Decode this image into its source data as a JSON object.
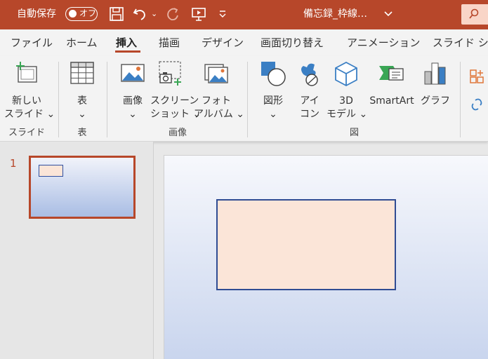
{
  "titlebar": {
    "autosave_label": "自動保存",
    "autosave_toggle": "オフ",
    "filename": "備忘録_枠線…",
    "bg_color": "#b7472a"
  },
  "tabs": [
    {
      "label": "ファイル"
    },
    {
      "label": "ホーム"
    },
    {
      "label": "挿入",
      "active": true
    },
    {
      "label": "描画"
    },
    {
      "label": "デザイン"
    },
    {
      "label": "画面切り替え"
    },
    {
      "label": "アニメーション"
    },
    {
      "label": "スライド ショ"
    }
  ],
  "ribbon": {
    "new_slide": {
      "line1": "新しい",
      "line2": "スライド ⌄"
    },
    "table": {
      "line1": "表",
      "line2": "⌄"
    },
    "image": {
      "line1": "画像",
      "line2": "⌄"
    },
    "screenshot": {
      "line1": "スクリーン",
      "line2": "ショット ⌄"
    },
    "photo_album": {
      "line1": "フォト",
      "line2": "アルバム ⌄"
    },
    "shapes": {
      "line1": "図形",
      "line2": "⌄"
    },
    "icons": {
      "line1": "アイ",
      "line2": "コン"
    },
    "models3d": {
      "line1": "3D",
      "line2": "モデル ⌄"
    },
    "smartart": {
      "line1": "SmartArt"
    },
    "chart": {
      "line1": "グラフ"
    },
    "groups": {
      "slides": "スライド",
      "table": "表",
      "images": "画像",
      "illustrations": "図"
    }
  },
  "slides_panel": {
    "slide_number": "1"
  },
  "colors": {
    "accent": "#b7472a",
    "shape_fill": "#fbe5d8",
    "shape_border": "#2f4c93"
  }
}
